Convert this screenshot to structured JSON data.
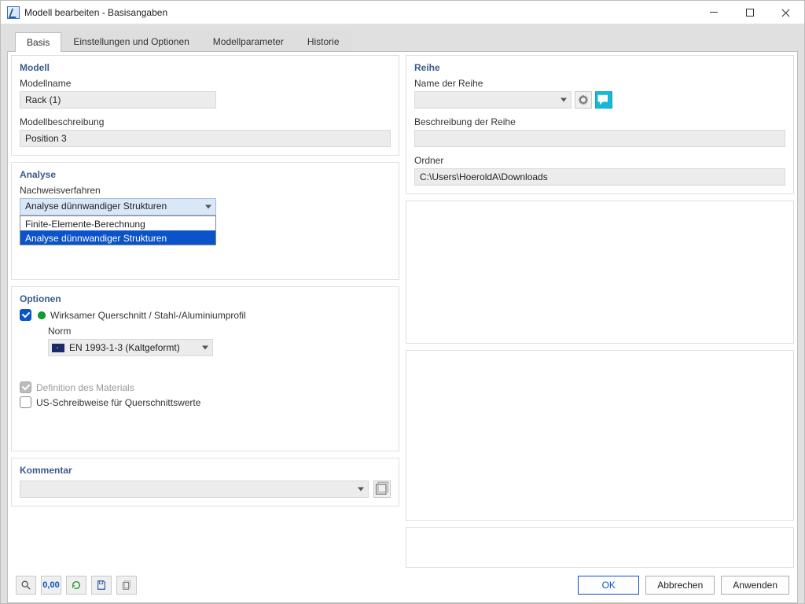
{
  "window": {
    "title": "Modell bearbeiten - Basisangaben"
  },
  "tabs": {
    "basis": "Basis",
    "einstellungen": "Einstellungen und Optionen",
    "parameter": "Modellparameter",
    "historie": "Historie"
  },
  "modell_group": {
    "title": "Modell",
    "name_label": "Modellname",
    "name_value": "Rack (1)",
    "desc_label": "Modellbeschreibung",
    "desc_value": "Position 3"
  },
  "analyse_group": {
    "title": "Analyse",
    "verfahren_label": "Nachweisverfahren",
    "selected": "Analyse dünnwandiger Strukturen",
    "options": [
      "Finite-Elemente-Berechnung",
      "Analyse dünnwandiger Strukturen"
    ]
  },
  "optionen_group": {
    "title": "Optionen",
    "wirkquerschnitt": "Wirksamer Querschnitt / Stahl-/Aluminiumprofil",
    "norm_label": "Norm",
    "norm_value": "EN 1993-1-3 (Kaltgeformt)",
    "definition_material": "Definition des Materials",
    "us_schreibweise": "US-Schreibweise für Querschnittswerte"
  },
  "kommentar_group": {
    "title": "Kommentar",
    "value": ""
  },
  "reihe_group": {
    "title": "Reihe",
    "name_label": "Name der Reihe",
    "name_value": "",
    "desc_label": "Beschreibung der Reihe",
    "desc_value": "",
    "ordner_label": "Ordner",
    "ordner_value": "C:\\Users\\HoeroldA\\Downloads"
  },
  "footer": {
    "ok": "OK",
    "abbrechen": "Abbrechen",
    "anwenden": "Anwenden"
  },
  "tool_labels": {
    "decimals": "0,00"
  }
}
